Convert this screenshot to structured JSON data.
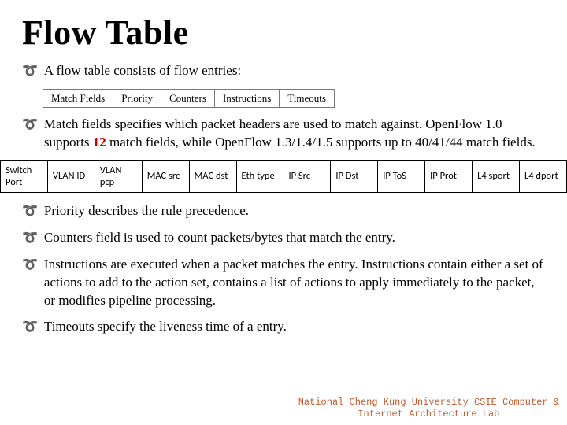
{
  "title": "Flow Table",
  "bullet1": "A flow table consists of flow entries:",
  "entry_fields": [
    "Match Fields",
    "Priority",
    "Counters",
    "Instructions",
    "Timeouts"
  ],
  "bullet2_pre": "Match fields specifies which packet headers are used to match against. OpenFlow 1.0 supports ",
  "bullet2_num": "12",
  "bullet2_post": " match fields, while OpenFlow 1.3/1.4/1.5 supports up to 40/41/44 match fields.",
  "match_headers": [
    "Switch Port",
    "VLAN ID",
    "VLAN pcp",
    "MAC src",
    "MAC dst",
    "Eth type",
    "IP Src",
    "IP Dst",
    "IP ToS",
    "IP Prot",
    "L4 sport",
    "L4 dport"
  ],
  "bullet3": "Priority describes the rule precedence.",
  "bullet4": "Counters field is used to count packets/bytes that match the entry.",
  "bullet5": "Instructions are executed when a packet matches the entry. Instructions contain either a set of actions to add to the action set, contains a list of actions to apply immediately to the packet, or modifies pipeline processing.",
  "bullet6": "Timeouts specify the liveness time of a entry.",
  "footer_line1": "National Cheng Kung University CSIE Computer &",
  "footer_line2": "Internet Architecture Lab"
}
